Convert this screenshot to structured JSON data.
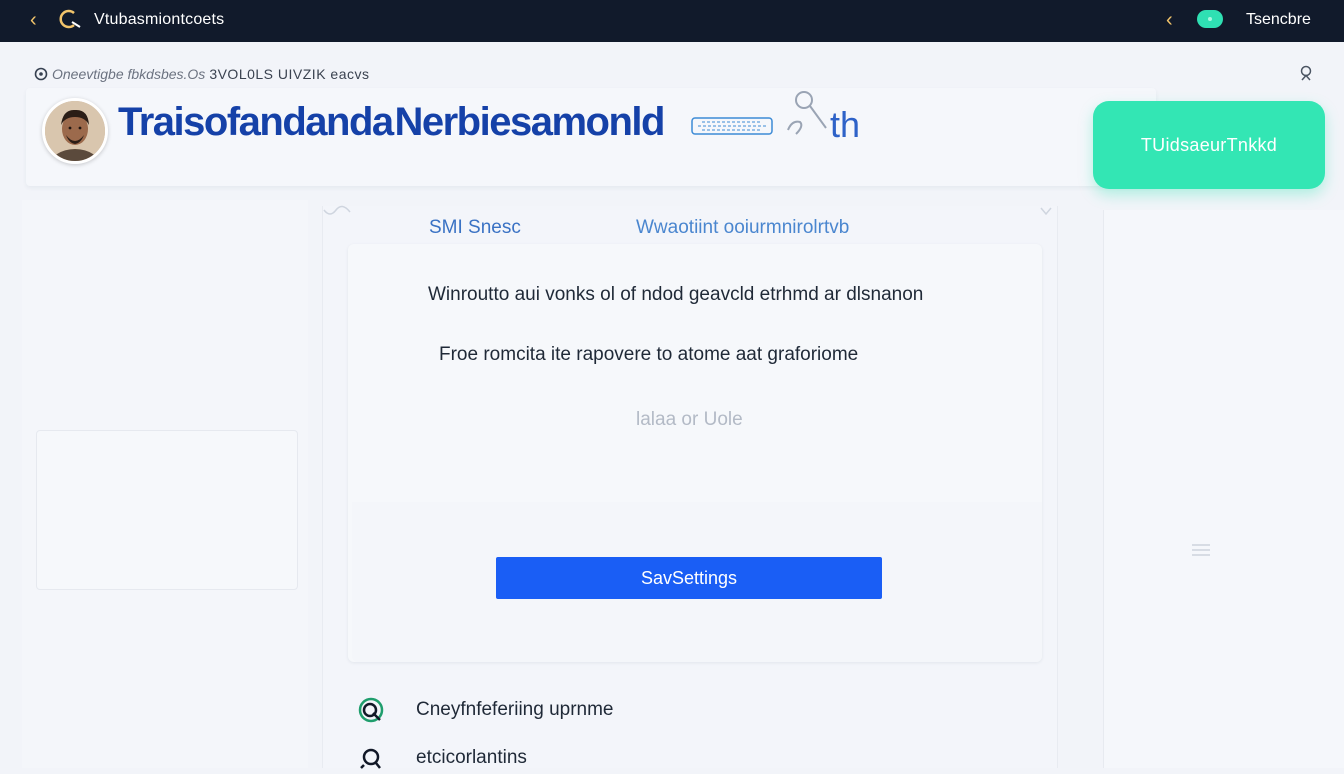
{
  "topbar": {
    "app_title": "Vtubasmiontcoets",
    "right_label": "Tsencbre"
  },
  "breadcrumb": {
    "prefix": "Oneevtigbe fbkdsbes.Os",
    "tail": "3VOL0LS UIVZIK eacvs"
  },
  "header": {
    "title": "Traisofandanda Nerbiesamonld",
    "title_suffix": "th",
    "cta_label": "TUidsaeurTnkkd"
  },
  "main": {
    "tabs": [
      {
        "label": "SMI Snesc"
      },
      {
        "label": "Wwaotiint ooiurmnirolrtvb"
      }
    ],
    "line_1": "Winroutto aui vonks  ol of ndod geavcld etrhmd ar dlsnanon",
    "line_2": "Froe romcita ite rapovere to   atome aat graforiome",
    "line_3": "lalaa  or Uole",
    "save_label": "SavSettings"
  },
  "options": [
    {
      "label": "Cneyfnfeferiing uprnme",
      "icon": "refresh-circle-icon"
    },
    {
      "label": "etcicorlantins",
      "icon": "search-icon"
    }
  ],
  "colors": {
    "topbar": "#111a2b",
    "accent_green": "#33e6b4",
    "primary_blue": "#1a5ef5",
    "title_blue": "#1541a8"
  }
}
